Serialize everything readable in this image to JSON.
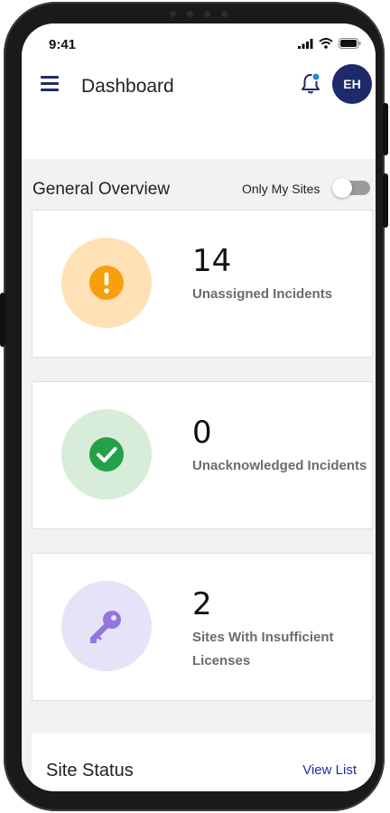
{
  "status_bar": {
    "time": "9:41"
  },
  "header": {
    "title": "Dashboard",
    "avatar_initials": "EH"
  },
  "overview": {
    "title": "General Overview",
    "toggle_label": "Only My Sites",
    "toggle_on": false
  },
  "cards": [
    {
      "count": "14",
      "label": "Unassigned Incidents",
      "icon": "exclamation-icon",
      "circle_color": "#ffe1b5",
      "icon_color": "#f5a00c"
    },
    {
      "count": "0",
      "label": "Unacknowledged Incidents",
      "icon": "checkmark-icon",
      "circle_color": "#d7ecd9",
      "icon_color": "#24a148"
    },
    {
      "count": "2",
      "label": "Sites With Insufficient Licenses",
      "icon": "key-icon",
      "circle_color": "#e6e2f7",
      "icon_color": "#9575dc"
    }
  ],
  "site_status": {
    "title": "Site Status",
    "link": "View List"
  },
  "colors": {
    "primary": "#1f2a6b",
    "link": "#2a2aa8",
    "background": "#f2f2f2"
  }
}
